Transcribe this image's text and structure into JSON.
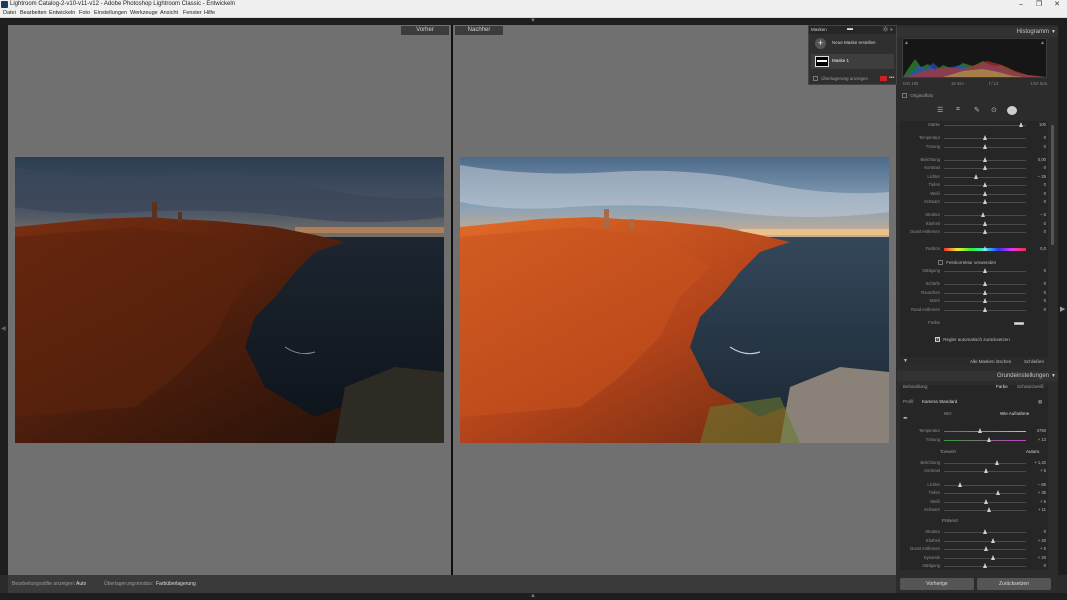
{
  "window": {
    "title": "Lightroom Catalog-2-v10-v11-v12 - Adobe Photoshop Lightroom Classic - Entwickeln",
    "controls": [
      "–",
      "❐",
      "✕"
    ]
  },
  "menu": [
    "Datei",
    "Bearbeiten",
    "Entwickeln",
    "Foto",
    "Einstellungen",
    "Werkzeuge",
    "Ansicht",
    "Fenster",
    "Hilfe"
  ],
  "compare": {
    "before_label": "Vorher",
    "after_label": "Nachher"
  },
  "toolbar": {
    "show_label": "Bearbeitungsstifte anzeigen:",
    "show_value": "Auto",
    "overlay_mode_label": "Überlagerungsmodus:",
    "overlay_mode_value": "Farbüberlagerung"
  },
  "masks": {
    "title": "Masken",
    "new_mask": "Neue Maske erstellen",
    "mask1": "Maske 1",
    "show_overlay": "Überlagerung anzeigen",
    "overlay_color": "#cc2222"
  },
  "histogram": {
    "title": "Histogramm",
    "info_left": "ISO 100",
    "info_mid1": "16 mm",
    "info_mid2": "f / 13",
    "info_right": "1/10 Sek.",
    "original_photo": "Originalfoto"
  },
  "mask_adjust": {
    "sliders": [
      {
        "label": "Stärke",
        "value": "100",
        "pos": 0.95
      },
      {
        "label": "Temperatur",
        "value": "0",
        "pos": 0.5
      },
      {
        "label": "Tönung",
        "value": "0",
        "pos": 0.5
      },
      {
        "label": "Belichtung",
        "value": "0,00",
        "pos": 0.5
      },
      {
        "label": "Kontrast",
        "value": "0",
        "pos": 0.5
      },
      {
        "label": "Lichter",
        "value": "– 25",
        "pos": 0.4
      },
      {
        "label": "Tiefen",
        "value": "0",
        "pos": 0.5
      },
      {
        "label": "Weiß",
        "value": "0",
        "pos": 0.5
      },
      {
        "label": "Schwarz",
        "value": "0",
        "pos": 0.5
      },
      {
        "label": "Struktur",
        "value": "– 5",
        "pos": 0.48
      },
      {
        "label": "Klarheit",
        "value": "0",
        "pos": 0.5
      },
      {
        "label": "Dunst entfernen",
        "value": "0",
        "pos": 0.5
      },
      {
        "label": "Farbton",
        "value": "0,0",
        "pos": 0.5
      },
      {
        "label": "Sättigung",
        "value": "0",
        "pos": 0.5
      },
      {
        "label": "Schärfe",
        "value": "0",
        "pos": 0.5
      },
      {
        "label": "Rauschen",
        "value": "0",
        "pos": 0.5
      },
      {
        "label": "Moiré",
        "value": "0",
        "pos": 0.5
      },
      {
        "label": "Rand entfernen",
        "value": "0",
        "pos": 0.5
      }
    ],
    "fine_adjust": "Feinkorrektur verwenden",
    "color_label": "Farbe",
    "auto_reset": "Regler automatisch zurücksetzen",
    "delete_all": "Alle Masken löschen",
    "close": "Schließen"
  },
  "basic": {
    "title": "Grundeinstellungen",
    "treatment": "Behandlung:",
    "color": "Farbe",
    "bw": "Schwarzweiß",
    "profile_label": "Profil:",
    "profile_value": "Kamera Standard",
    "wb_label": "WA:",
    "wb_value": "Wie Aufnahme",
    "tone_label": "Tonwert",
    "auto_label": "Autom.",
    "presence_label": "Präsenz",
    "sliders": [
      {
        "label": "Temperatur",
        "value": "4750",
        "pos": 0.45
      },
      {
        "label": "Tönung",
        "value": "+ 13",
        "pos": 0.55
      },
      {
        "label": "Belichtung",
        "value": "+ 1,42",
        "pos": 0.65
      },
      {
        "label": "Kontrast",
        "value": "+ 5",
        "pos": 0.52
      },
      {
        "label": "Lichter",
        "value": "– 66",
        "pos": 0.2
      },
      {
        "label": "Tiefen",
        "value": "+ 35",
        "pos": 0.67
      },
      {
        "label": "Weiß",
        "value": "+ 5",
        "pos": 0.52
      },
      {
        "label": "Schwarz",
        "value": "+ 11",
        "pos": 0.55
      },
      {
        "label": "Struktur",
        "value": "0",
        "pos": 0.5
      },
      {
        "label": "Klarheit",
        "value": "+ 20",
        "pos": 0.6
      },
      {
        "label": "Dunst entfernen",
        "value": "+ 5",
        "pos": 0.52
      },
      {
        "label": "Dynamik",
        "value": "+ 20",
        "pos": 0.6
      },
      {
        "label": "Sättigung",
        "value": "0",
        "pos": 0.5
      }
    ]
  },
  "buttons": {
    "previous": "Vorherige",
    "reset": "Zurücksetzen"
  }
}
